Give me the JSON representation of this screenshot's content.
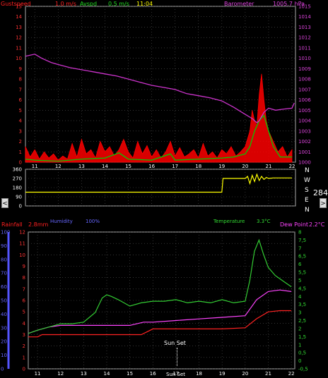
{
  "header": {
    "gustspeed_label": "Gustspeed",
    "gustspeed_value": "1.0 m/s",
    "avspd_label": "Avspd",
    "avspd_value": "0.5 m/s",
    "time": "11:04",
    "barometer_label": "Barometer",
    "barometer_value": "1005.7 hPa"
  },
  "wind_dir": {
    "current": "284°",
    "compass": [
      "N",
      "W",
      "S",
      "E",
      "N"
    ]
  },
  "lower_header": {
    "rainfall_label": "Rainfall",
    "rainfall_value": "2.8mm",
    "humidity_label": "Humidity",
    "humidity_value": "100%",
    "temperature_label": "Temperature",
    "temperature_value": "3.3°C",
    "dewpoint_label": "Dew Point",
    "dewpoint_value": "2.2°C"
  },
  "annotations": {
    "sunset_label": "Sun Set",
    "sunset_axis_label": "Sun Set"
  },
  "colors": {
    "gust": "#ff0000",
    "avspd": "#00cc00",
    "barometer": "#cc33cc",
    "winddir": "#ffff00",
    "rain": "#ff2222",
    "humidity": "#5555ff",
    "temperature": "#33cc33",
    "dewpoint": "#ff44ff"
  },
  "chart_data": [
    {
      "type": "line",
      "name": "wind-barometer",
      "x_ticks": [
        "11",
        "12",
        "13",
        "14",
        "15",
        "16",
        "17",
        "18",
        "19",
        "20",
        "21",
        "22"
      ],
      "y_left_ticks": [
        "0",
        "1",
        "2",
        "3",
        "4",
        "5",
        "6",
        "7",
        "8",
        "9",
        "10",
        "11",
        "12",
        "13",
        "14",
        "15"
      ],
      "y_right_ticks": [
        "1000",
        "1001",
        "1002",
        "1003",
        "1004",
        "1005",
        "1006",
        "1007",
        "1008",
        "1009",
        "1010",
        "1011",
        "1012",
        "1013",
        "1014",
        "1015"
      ],
      "ylim_left": [
        0,
        15
      ],
      "ylim_right": [
        1000,
        1015
      ],
      "series": [
        {
          "name": "Barometer",
          "axis": "right",
          "x": [
            10.6,
            11.0,
            11.3,
            11.7,
            12.0,
            12.5,
            13.0,
            13.5,
            14.0,
            14.5,
            15.0,
            15.5,
            16.0,
            16.5,
            17.0,
            17.5,
            18.0,
            18.5,
            19.0,
            19.5,
            20.0,
            20.3,
            20.5,
            20.6,
            20.8,
            21.0,
            21.3,
            21.6,
            22.0,
            22.1
          ],
          "y": [
            1010.2,
            1010.4,
            1010.0,
            1009.6,
            1009.4,
            1009.1,
            1008.9,
            1008.7,
            1008.5,
            1008.3,
            1008.0,
            1007.7,
            1007.4,
            1007.2,
            1007.0,
            1006.6,
            1006.4,
            1006.2,
            1005.9,
            1005.3,
            1004.6,
            1004.2,
            1003.8,
            1004.0,
            1004.8,
            1005.2,
            1005.0,
            1005.1,
            1005.2,
            1005.7
          ]
        },
        {
          "name": "Gustspeed",
          "axis": "left",
          "x": [
            10.6,
            10.8,
            11.0,
            11.2,
            11.4,
            11.6,
            11.8,
            12.0,
            12.2,
            12.4,
            12.6,
            12.8,
            13.0,
            13.2,
            13.4,
            13.6,
            13.8,
            14.0,
            14.2,
            14.4,
            14.6,
            14.8,
            15.0,
            15.2,
            15.4,
            15.6,
            15.8,
            16.0,
            16.2,
            16.4,
            16.6,
            16.8,
            17.0,
            17.2,
            17.4,
            17.6,
            17.8,
            18.0,
            18.2,
            18.4,
            18.6,
            18.8,
            19.0,
            19.2,
            19.4,
            19.6,
            19.8,
            20.0,
            20.2,
            20.3,
            20.4,
            20.5,
            20.6,
            20.7,
            20.8,
            20.9,
            21.0,
            21.2,
            21.4,
            21.6,
            21.8,
            22.0
          ],
          "y": [
            1.5,
            0.5,
            1.2,
            0.3,
            1.0,
            0.4,
            0.8,
            0.2,
            0.6,
            0.3,
            1.8,
            0.5,
            2.2,
            0.8,
            1.2,
            0.4,
            2.0,
            1.0,
            1.5,
            0.6,
            1.2,
            2.2,
            1.0,
            0.4,
            2.0,
            0.8,
            1.6,
            0.5,
            1.2,
            0.4,
            1.0,
            2.0,
            0.6,
            1.4,
            0.5,
            0.8,
            1.2,
            0.4,
            1.8,
            0.6,
            1.0,
            0.4,
            1.2,
            0.8,
            1.5,
            0.6,
            1.0,
            1.5,
            3.0,
            5.0,
            4.0,
            3.5,
            6.5,
            8.5,
            6.0,
            4.0,
            3.0,
            2.0,
            1.0,
            1.5,
            0.5,
            1.2
          ]
        },
        {
          "name": "Avspd",
          "axis": "left",
          "x": [
            10.6,
            11.0,
            12.0,
            13.0,
            14.0,
            14.6,
            15.0,
            16.0,
            16.8,
            17.0,
            18.0,
            19.0,
            19.5,
            20.0,
            20.2,
            20.4,
            20.6,
            20.8,
            21.0,
            21.2,
            21.5,
            22.0
          ],
          "y": [
            0.3,
            0.2,
            0.1,
            0.3,
            0.4,
            0.9,
            0.3,
            0.2,
            0.8,
            0.2,
            0.3,
            0.4,
            0.5,
            0.8,
            1.5,
            3.0,
            4.0,
            4.5,
            3.0,
            1.5,
            0.5,
            0.5
          ]
        }
      ]
    },
    {
      "type": "line",
      "name": "wind-direction",
      "y_ticks": [
        "0",
        "90",
        "180",
        "270",
        "360"
      ],
      "ylim": [
        0,
        360
      ],
      "series": [
        {
          "name": "Wind direction",
          "x": [
            10.6,
            19.0,
            19.05,
            20.0,
            20.1,
            20.2,
            20.3,
            20.4,
            20.5,
            20.6,
            20.7,
            20.8,
            20.9,
            21.0,
            21.2,
            22.0
          ],
          "y": [
            135,
            135,
            270,
            270,
            290,
            220,
            300,
            240,
            310,
            250,
            290,
            260,
            280,
            270,
            275,
            275
          ]
        }
      ]
    },
    {
      "type": "line",
      "name": "temperature-humidity-rain",
      "x_ticks": [
        "11",
        "12",
        "13",
        "14",
        "15",
        "16",
        "17",
        "18",
        "19",
        "20",
        "21",
        "22"
      ],
      "y_left_ticks": [
        "0",
        "10",
        "20",
        "30",
        "40",
        "50",
        "60",
        "70",
        "80",
        "90",
        "100"
      ],
      "y_mid_ticks": [
        "0",
        "1",
        "2",
        "3",
        "4",
        "5",
        "6",
        "7",
        "8",
        "9",
        "10",
        "11",
        "12"
      ],
      "y_right_ticks": [
        "-0,5",
        "0",
        "0,5",
        "1",
        "1,5",
        "2",
        "2,5",
        "3",
        "3,5",
        "4",
        "4,5",
        "5",
        "5,5",
        "6",
        "6,5",
        "7",
        "7,5",
        "8"
      ],
      "ylim_left": [
        0,
        100
      ],
      "ylim_right": [
        -0.5,
        8
      ],
      "series": [
        {
          "name": "Temperature",
          "axis": "right",
          "x": [
            10.6,
            11.0,
            11.5,
            12.0,
            12.5,
            13.0,
            13.5,
            13.8,
            14.0,
            14.2,
            14.5,
            15.0,
            15.5,
            16.0,
            16.5,
            17.0,
            17.5,
            18.0,
            18.5,
            19.0,
            19.5,
            20.0,
            20.2,
            20.4,
            20.6,
            20.8,
            21.0,
            21.3,
            21.6,
            22.0
          ],
          "y": [
            1.7,
            1.9,
            2.1,
            2.3,
            2.3,
            2.4,
            3.0,
            3.9,
            4.1,
            4.0,
            3.8,
            3.4,
            3.6,
            3.7,
            3.7,
            3.8,
            3.6,
            3.7,
            3.6,
            3.8,
            3.6,
            3.7,
            5.0,
            6.8,
            7.5,
            6.6,
            5.8,
            5.3,
            5.0,
            4.6
          ]
        },
        {
          "name": "Dew Point",
          "axis": "right",
          "x": [
            10.6,
            11.0,
            11.5,
            12.0,
            12.5,
            13.0,
            14.0,
            15.0,
            15.6,
            16.0,
            17.0,
            18.0,
            19.0,
            20.0,
            20.5,
            21.0,
            21.5,
            22.0
          ],
          "y": [
            1.7,
            1.9,
            2.1,
            2.2,
            2.2,
            2.2,
            2.2,
            2.2,
            2.4,
            2.4,
            2.5,
            2.6,
            2.7,
            2.8,
            3.8,
            4.3,
            4.4,
            4.3
          ]
        },
        {
          "name": "Rainfall",
          "axis": "mid",
          "x": [
            10.6,
            11.0,
            11.2,
            12.0,
            13.0,
            14.0,
            15.0,
            15.5,
            16.0,
            17.0,
            18.0,
            19.0,
            20.0,
            20.5,
            21.0,
            21.5,
            22.0
          ],
          "y": [
            2.8,
            2.8,
            3.0,
            3.0,
            3.0,
            3.0,
            3.0,
            3.0,
            3.5,
            3.5,
            3.5,
            3.5,
            3.6,
            4.4,
            5.0,
            5.1,
            5.1
          ]
        }
      ]
    }
  ]
}
